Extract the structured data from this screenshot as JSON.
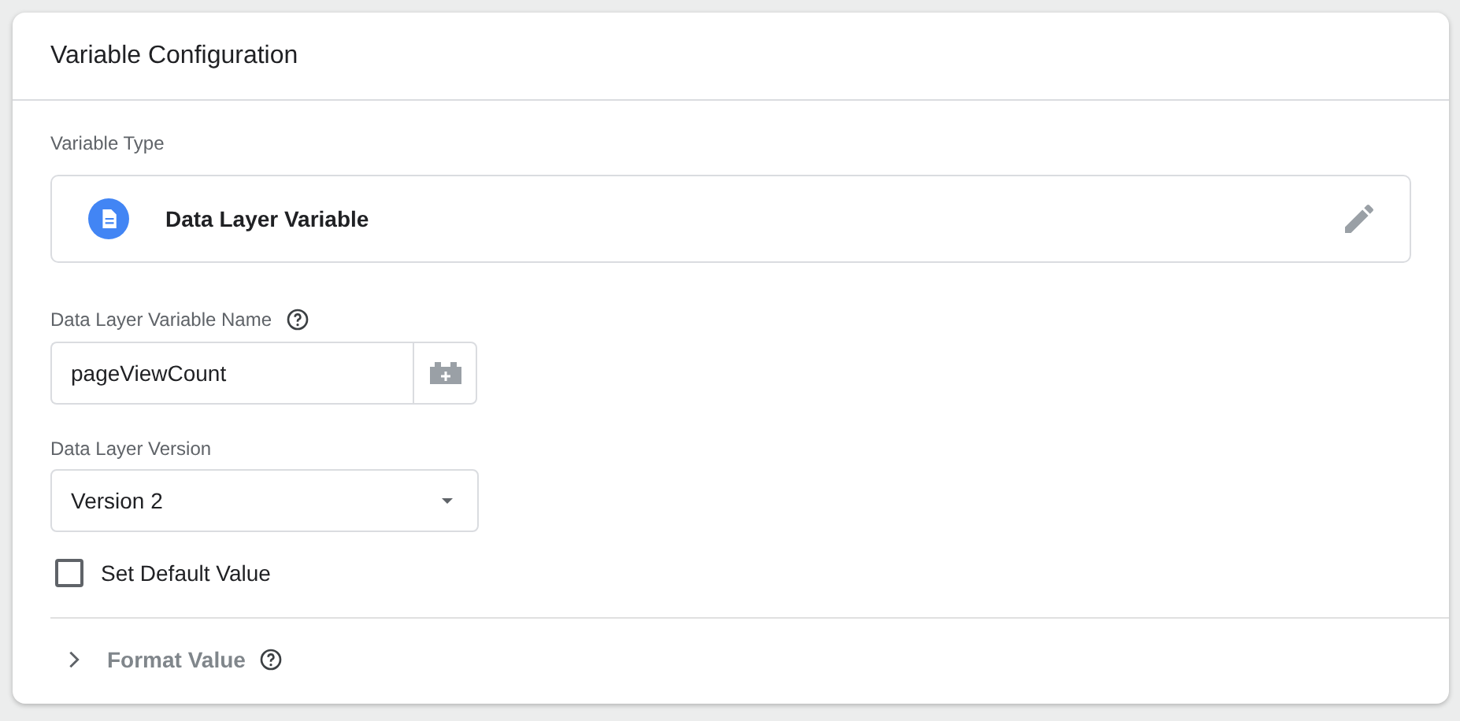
{
  "card": {
    "title": "Variable Configuration"
  },
  "variable_type": {
    "label": "Variable Type",
    "value": "Data Layer Variable"
  },
  "name_field": {
    "label": "Data Layer Variable Name",
    "value": "pageViewCount"
  },
  "version_select": {
    "label": "Data Layer Version",
    "value": "Version 2"
  },
  "default_value": {
    "label": "Set Default Value",
    "checked": false
  },
  "format_value": {
    "label": "Format Value",
    "expanded": false
  }
}
